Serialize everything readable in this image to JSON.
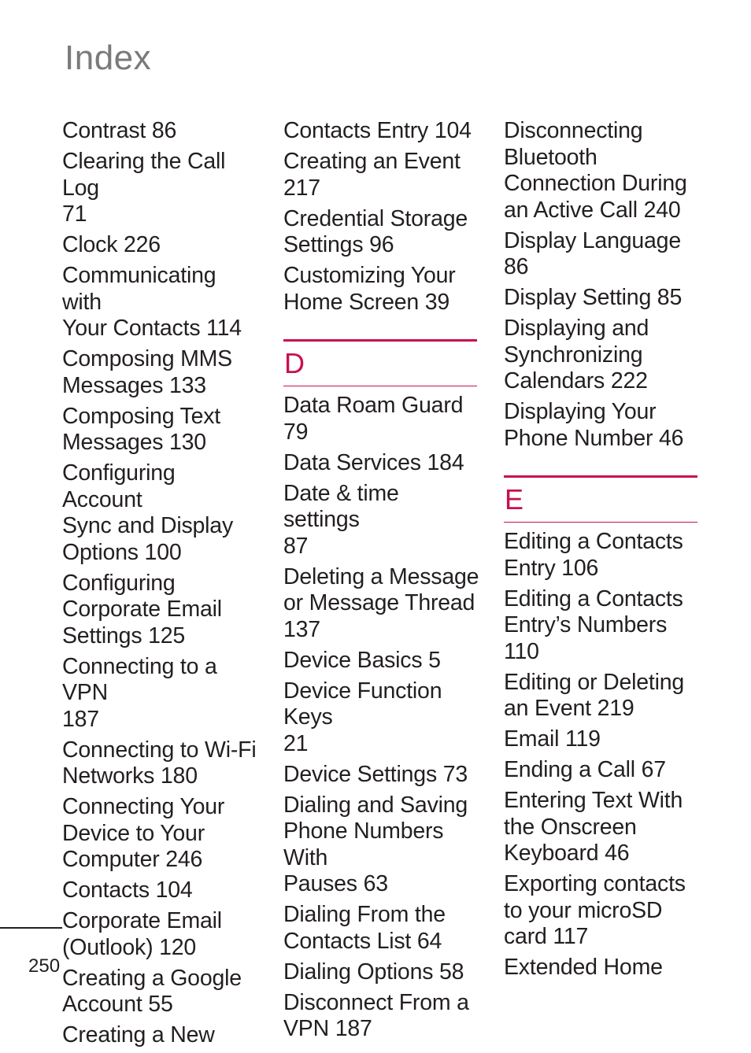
{
  "page": {
    "title": "Index",
    "page_number": "250",
    "accent_color": "#c8104f"
  },
  "columns": [
    {
      "entries": [
        "Contrast 86",
        "Clearing the Call Log\n71",
        "Clock 226",
        "Communicating with\nYour Contacts 114",
        "Composing MMS\nMessages 133",
        "Composing Text\nMessages 130",
        "Configuring Account\nSync and Display\nOptions 100",
        "Configuring\nCorporate Email\nSettings 125",
        "Connecting to a VPN\n187",
        "Connecting to Wi-Fi\nNetworks 180",
        "Connecting Your\nDevice to Your\nComputer 246",
        "Contacts 104",
        "Corporate Email\n(Outlook) 120",
        "Creating a Google\nAccount 55",
        "Creating a New"
      ]
    },
    {
      "entries": [
        "Contacts Entry 104",
        "Creating an Event\n217",
        "Credential Storage\nSettings 96",
        "Customizing Your\nHome Screen 39"
      ],
      "section": {
        "letter": "D",
        "entries": [
          "Data Roam Guard 79",
          "Data Services 184",
          "Date & time settings\n87",
          "Deleting a Message\nor Message Thread\n137",
          "Device Basics 5",
          "Device Function Keys\n21",
          "Device Settings 73",
          "Dialing and Saving\nPhone Numbers With\nPauses 63",
          "Dialing From the\nContacts List 64",
          "Dialing Options 58",
          "Disconnect From a\nVPN 187"
        ]
      }
    },
    {
      "entries": [
        "Disconnecting\nBluetooth\nConnection During\nan Active Call 240",
        "Display Language 86",
        "Display Setting 85",
        "Displaying and\nSynchronizing\nCalendars 222",
        "Displaying Your\nPhone Number 46"
      ],
      "section": {
        "letter": "E",
        "entries": [
          "Editing a Contacts\nEntry 106",
          "Editing a Contacts\nEntry’s Numbers 110",
          "Editing or Deleting\nan Event 219",
          "Email 119",
          "Ending a Call 67",
          "Entering Text With\nthe Onscreen\nKeyboard 46",
          "Exporting contacts\nto your microSD\ncard 117",
          "Extended Home"
        ]
      }
    }
  ]
}
